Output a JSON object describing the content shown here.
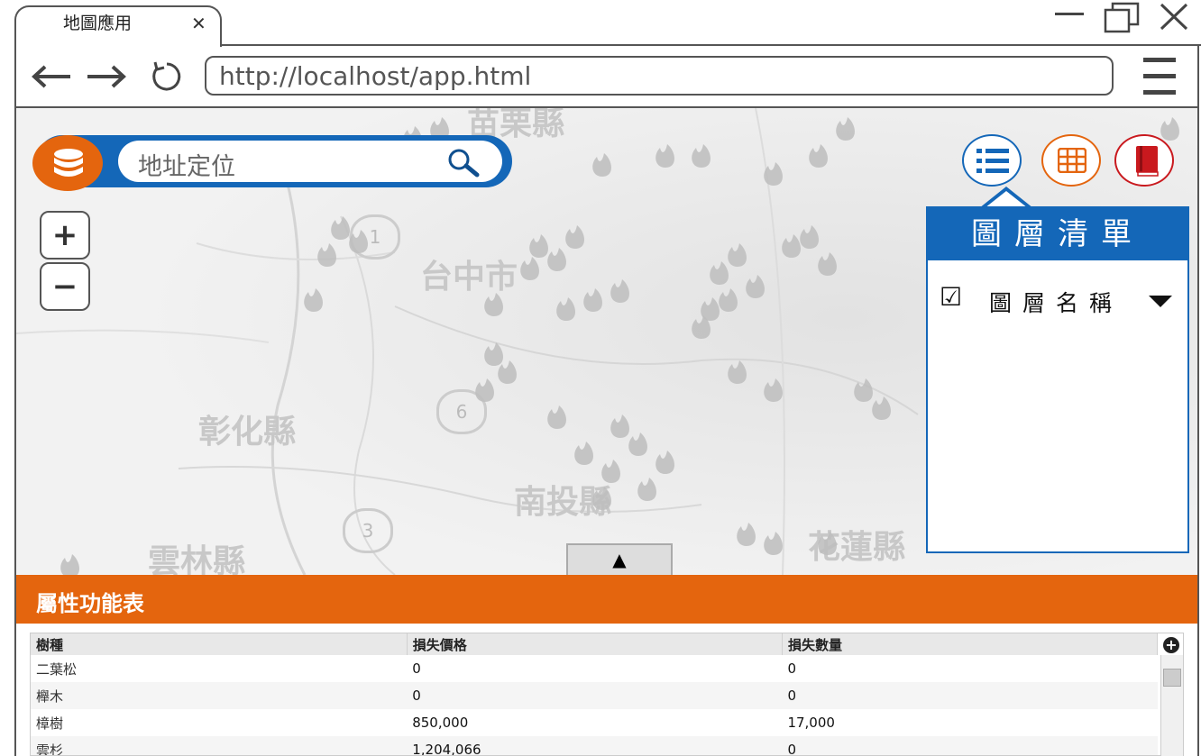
{
  "browser": {
    "tab_title": "地圖應用",
    "tab_close": "✕",
    "url": "http://localhost/app.html",
    "minimize_label": "—",
    "close_label": "✕"
  },
  "map": {
    "place_labels": [
      "苗栗縣",
      "台中市",
      "彰化縣",
      "南投縣",
      "雲林縣",
      "花蓮縣"
    ],
    "road_shields": [
      "1",
      "6",
      "3"
    ]
  },
  "search": {
    "placeholder": "地址定位"
  },
  "zoom": {
    "in_label": "+",
    "out_label": "−"
  },
  "layer_panel": {
    "title": "圖層清單",
    "items": [
      {
        "checked": "☑",
        "name": "圖層名稱"
      }
    ]
  },
  "toggle_label": "▲",
  "attribute_table": {
    "title": "屬性功能表",
    "columns": [
      "樹種",
      "損失價格",
      "損失數量"
    ],
    "rows": [
      [
        "二葉松",
        "0",
        "0"
      ],
      [
        "櫸木",
        "0",
        "0"
      ],
      [
        "樟樹",
        "850,000",
        "17,000"
      ],
      [
        "雲杉",
        "1,204,066",
        "0"
      ]
    ]
  },
  "colors": {
    "primary_blue": "#1467b8",
    "accent_orange": "#e4650e",
    "book_red": "#c9191e"
  },
  "icons": [
    "database-icon",
    "search-icon",
    "list-icon",
    "table-icon",
    "book-icon",
    "fire-marker-icon"
  ]
}
